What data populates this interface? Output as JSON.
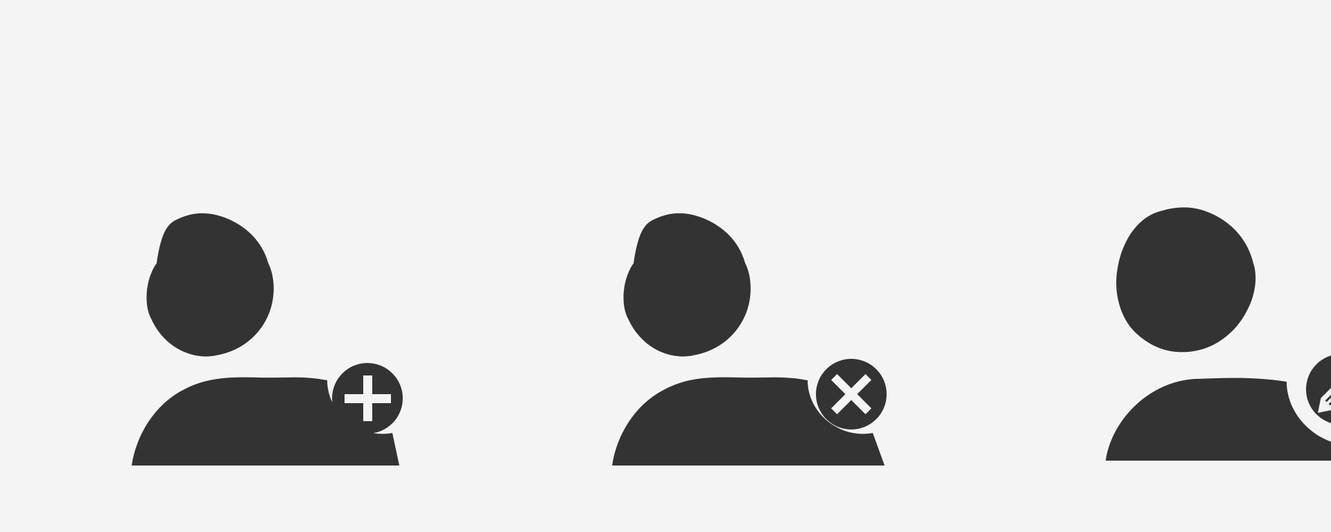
{
  "background_color": "#f3f4f3",
  "icon_color": "#333333",
  "icons": [
    {
      "name": "user-add-icon",
      "badge": "plus"
    },
    {
      "name": "user-remove-icon",
      "badge": "cross"
    },
    {
      "name": "user-edit-icon",
      "badge": "pencil"
    }
  ]
}
